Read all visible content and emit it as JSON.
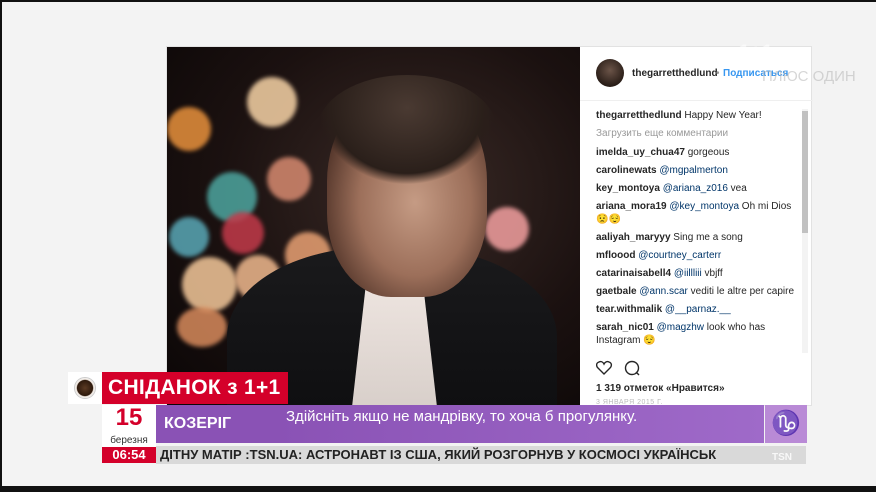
{
  "post": {
    "username": "thegarretthedlund",
    "separator": "•",
    "follow_label": "Подписаться",
    "caption_user": "thegarretthedlund",
    "caption_text": " Happy New Year!",
    "load_more": "Загрузить еще комментарии",
    "comments": [
      {
        "user": "imelda_uy_chua47",
        "text": " gorgeous",
        "mention": ""
      },
      {
        "user": "carolinewats",
        "text": "",
        "mention": " @mgpalmerton"
      },
      {
        "user": "key_montoya",
        "text": " vea",
        "mention": " @ariana_z016"
      },
      {
        "user": "ariana_mora19",
        "text": " Oh mi Dios 😟😌",
        "mention": " @key_montoya"
      },
      {
        "user": "aaliyah_maryyy",
        "text": " Sing me a song",
        "mention": ""
      },
      {
        "user": "mfloood",
        "text": "",
        "mention": " @courtney_carterr"
      },
      {
        "user": "catarinaisabell4",
        "text": " vbjff",
        "mention": " @iillliii"
      },
      {
        "user": "gaetbale",
        "text": " vediti le altre per capire",
        "mention": " @ann.scar"
      },
      {
        "user": "tear.withmalik",
        "text": "",
        "mention": " @__parnaz.__"
      },
      {
        "user": "sarah_nic01",
        "text": " look who has Instagram 😌",
        "mention": " @magzhw"
      }
    ],
    "likes": "1 319 отметок «Нравится»",
    "date": "3 ЯНВАРЯ 2015 Г."
  },
  "watermark": {
    "logo": "1+1",
    "text": "ПЛЮС ОДИН"
  },
  "broadcast": {
    "show_title": "СНІДАНОК з 1+1",
    "day": "15",
    "month": "березня",
    "sign": "КОЗЕРІГ",
    "forecast": "Здійсніть якщо не мандрівку, то хоча б прогулянку.",
    "zodiac_symbol": "♑",
    "time": "06:54",
    "ticker": "ДІТНУ МАТІР   :TSN.UA:   АСТРОНАВТ ІЗ США, ЯКИЙ РОЗГОРНУВ У КОСМОСІ УКРАЇНСЬК",
    "ticker_brand": "TSN",
    "accent": "#d4002a",
    "band_color": "#8a52b5"
  }
}
